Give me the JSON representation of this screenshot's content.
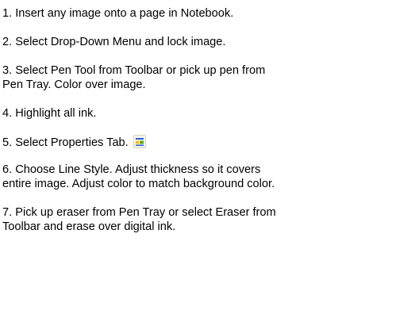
{
  "steps": [
    {
      "lines": [
        "1.  Insert any image onto a page in Notebook."
      ]
    },
    {
      "lines": [
        "2.  Select Drop-Down Menu and lock image."
      ]
    },
    {
      "lines": [
        "3.  Select Pen Tool from Toolbar or pick up pen from",
        "Pen Tray.  Color over image."
      ]
    },
    {
      "lines": [
        "4.  Highlight all ink."
      ]
    },
    {
      "lines": [
        "5.  Select Properties Tab."
      ],
      "icon": "properties-tab-icon"
    },
    {
      "lines": [
        "6.  Choose Line Style.  Adjust thickness so it covers",
        "entire image.  Adjust color to match background color."
      ]
    },
    {
      "lines": [
        "7.  Pick up eraser from Pen Tray or select Eraser from",
        "Toolbar and erase over digital ink."
      ]
    }
  ],
  "colors": {
    "text": "#000000",
    "background": "#ffffff",
    "icon_frame": "#d9d4b8",
    "icon_blue": "#2a5bd7",
    "icon_yellow": "#f2c21b",
    "icon_green": "#5aa83a"
  }
}
